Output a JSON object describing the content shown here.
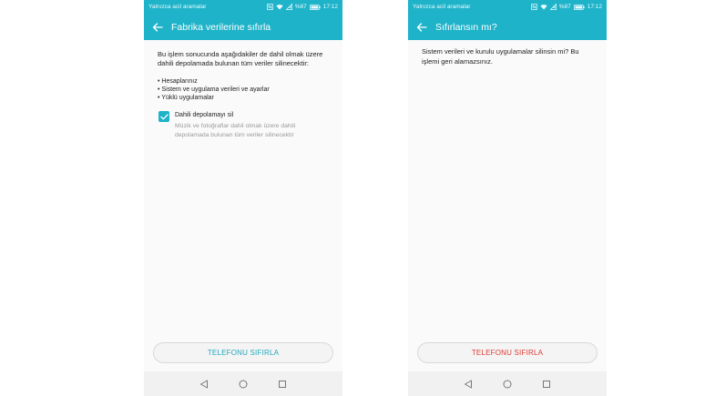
{
  "left": {
    "status": {
      "carrier": "Yalnızca acil aramalar",
      "battery": "%87",
      "time": "17:12"
    },
    "title": "Fabrika verilerine sıfırla",
    "intro": "Bu işlem sonucunda aşağıdakiler de dahil olmak üzere dahili depolamada bulunan tüm veriler silinecektir:",
    "bullets": [
      "Hesaplarınız",
      "Sistem ve uygulama verileri ve ayarlar",
      "Yüklü uygulamalar"
    ],
    "option": {
      "label": "Dahili depolamayı sil",
      "checked": true,
      "description": "Müzik ve fotoğraflar dahil olmak üzere dahili depolamada bulunan tüm veriler silinecektir"
    },
    "button": "TELEFONU SIFIRLA"
  },
  "right": {
    "status": {
      "carrier": "Yalnızca acil aramalar",
      "battery": "%87",
      "time": "17:12"
    },
    "title": "Sıfırlansın mı?",
    "message": "Sistem verileri ve kurulu uygulamalar silinsin mi? Bu işlemi geri alamazsınız.",
    "button": "TELEFONU SIFIRLA"
  },
  "icons": {
    "back": "arrow-left-icon",
    "nfc": "nfc-icon",
    "wifi": "wifi-icon",
    "signal": "no-signal-icon",
    "battery": "battery-icon",
    "nav_back": "triangle-back-icon",
    "nav_home": "circle-home-icon",
    "nav_recent": "square-recent-icon"
  },
  "colors": {
    "accent": "#1fb3c9",
    "danger": "#e03a32",
    "secondary_text": "#9a9a9a"
  }
}
